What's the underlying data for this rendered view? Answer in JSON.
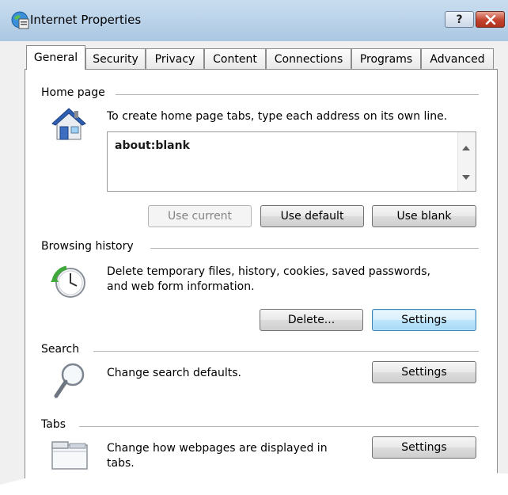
{
  "window": {
    "title": "Internet Properties",
    "help_label": "?",
    "close_label": "✕"
  },
  "tabs": [
    {
      "label": "General",
      "active": true
    },
    {
      "label": "Security"
    },
    {
      "label": "Privacy"
    },
    {
      "label": "Content"
    },
    {
      "label": "Connections"
    },
    {
      "label": "Programs"
    },
    {
      "label": "Advanced"
    }
  ],
  "home_page": {
    "section_label": "Home page",
    "description": "To create home page tabs, type each address on its own line.",
    "address_value": "about:blank",
    "use_current_label": "Use current",
    "use_default_label": "Use default",
    "use_blank_label": "Use blank",
    "icon": "house-icon"
  },
  "browsing_history": {
    "section_label": "Browsing history",
    "description_line1": "Delete temporary files, history, cookies, saved passwords,",
    "description_line2": "and web form information.",
    "delete_label": "Delete...",
    "settings_label": "Settings",
    "icon": "history-clock-icon"
  },
  "search": {
    "section_label": "Search",
    "description": "Change search defaults.",
    "settings_label": "Settings",
    "icon": "magnifier-icon"
  },
  "tabs_section": {
    "section_label": "Tabs",
    "description_line1": "Change how webpages are displayed in",
    "description_line2": "tabs.",
    "settings_label": "Settings",
    "icon": "tabs-window-icon"
  },
  "colors": {
    "titlebar": "#bcd4ea",
    "close_button": "#c2432c",
    "focused_button": "#3c7fb1"
  }
}
